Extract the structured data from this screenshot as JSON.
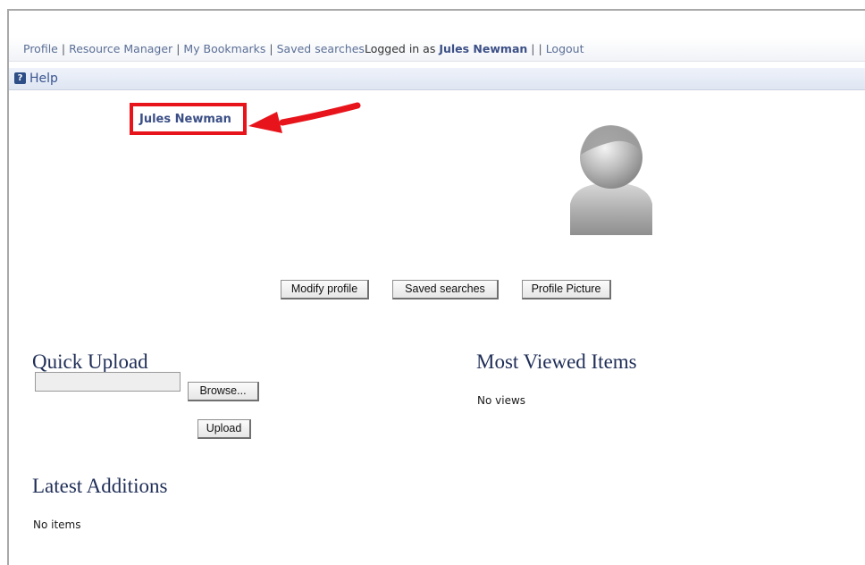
{
  "nav": {
    "links": [
      "Profile",
      "Resource Manager",
      "My Bookmarks",
      "Saved searches"
    ],
    "logged_prefix": "Logged in as ",
    "username": "Jules Newman",
    "trailing_sep": "| |",
    "logout": "Logout"
  },
  "help": {
    "icon": "help-question-icon",
    "label": "Help"
  },
  "profile": {
    "name": "Jules Newman",
    "highlight_color": "#e8141b",
    "avatar_icon": "default-user-avatar-icon"
  },
  "actions": {
    "modify_profile": "Modify profile",
    "saved_searches": "Saved searches",
    "profile_picture": "Profile Picture"
  },
  "quick_upload": {
    "title": "Quick Upload",
    "file_value": "",
    "browse": "Browse...",
    "upload": "Upload"
  },
  "most_viewed": {
    "title": "Most Viewed Items",
    "empty": "No views"
  },
  "latest": {
    "title": "Latest Additions",
    "empty": "No items"
  }
}
